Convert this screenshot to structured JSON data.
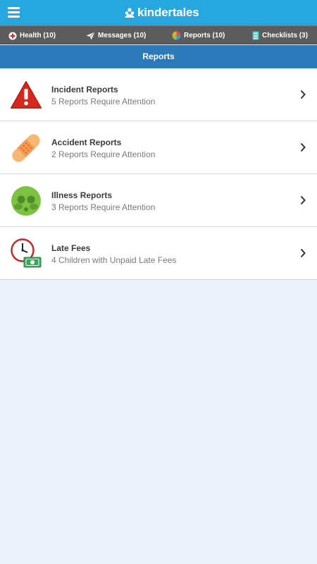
{
  "app": {
    "logo_text": "kindertales"
  },
  "colors": {
    "topbar": "#27a7df",
    "navbar": "#5c5c5c",
    "section_header": "#2b79b8",
    "background": "#eaf1f9"
  },
  "nav": {
    "items": [
      {
        "label": "Health (10)",
        "icon": "health-cross-icon"
      },
      {
        "label": "Messages (10)",
        "icon": "paper-plane-icon"
      },
      {
        "label": "Reports (10)",
        "icon": "pie-chart-icon"
      },
      {
        "label": "Checklists (3)",
        "icon": "checklist-icon"
      }
    ]
  },
  "section": {
    "title": "Reports"
  },
  "reports": [
    {
      "title": "Incident Reports",
      "subtitle": "5 Reports Require Attention",
      "icon": "warning-triangle-icon"
    },
    {
      "title": "Accident Reports",
      "subtitle": "2 Reports Require Attention",
      "icon": "bandage-icon"
    },
    {
      "title": "Illness Reports",
      "subtitle": "3 Reports Require Attention",
      "icon": "sick-face-icon"
    },
    {
      "title": "Late Fees",
      "subtitle": "4 Children with Unpaid Late Fees",
      "icon": "clock-money-icon"
    }
  ]
}
